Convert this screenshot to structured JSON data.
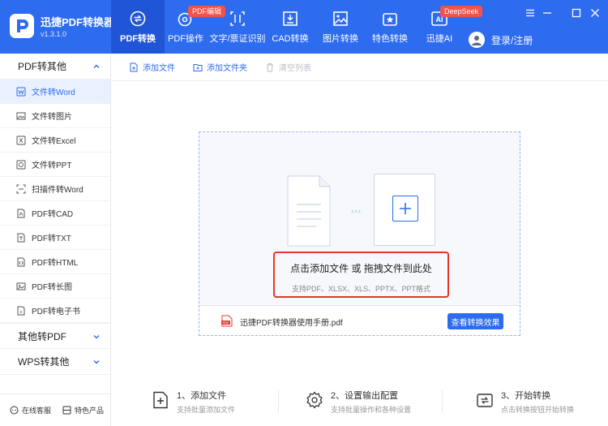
{
  "app": {
    "name": "迅捷PDF转换器",
    "version": "v1.3.1.0"
  },
  "nav": {
    "tabs": [
      {
        "label": "PDF转换",
        "icon": "convert-icon",
        "active": true
      },
      {
        "label": "PDF操作",
        "icon": "pdf-operate-icon",
        "badge": "PDF编辑"
      },
      {
        "label": "文字/票证识别",
        "icon": "ocr-scan-icon"
      },
      {
        "label": "CAD转换",
        "icon": "cad-icon"
      },
      {
        "label": "图片转换",
        "icon": "image-icon"
      },
      {
        "label": "特色转换",
        "icon": "star-icon"
      },
      {
        "label": "迅捷AI",
        "icon": "ai-icon",
        "badge": "DeepSeek"
      }
    ],
    "login_label": "登录/注册"
  },
  "sidebar": {
    "groups": [
      {
        "title": "PDF转其他",
        "expanded": true,
        "items": [
          {
            "label": "文件转Word",
            "icon": "word-icon",
            "active": true
          },
          {
            "label": "文件转图片",
            "icon": "picture-icon"
          },
          {
            "label": "文件转Excel",
            "icon": "excel-icon"
          },
          {
            "label": "文件转PPT",
            "icon": "ppt-icon"
          },
          {
            "label": "扫描件转Word",
            "icon": "scan-icon"
          },
          {
            "label": "PDF转CAD",
            "icon": "cad-file-icon"
          },
          {
            "label": "PDF转TXT",
            "icon": "txt-icon"
          },
          {
            "label": "PDF转HTML",
            "icon": "html-icon"
          },
          {
            "label": "PDF转长图",
            "icon": "long-image-icon"
          },
          {
            "label": "PDF转电子书",
            "icon": "ebook-icon"
          }
        ]
      },
      {
        "title": "其他转PDF",
        "expanded": false
      },
      {
        "title": "WPS转其他",
        "expanded": false
      }
    ],
    "footer": {
      "service_label": "在线客服",
      "features_label": "特色产品"
    }
  },
  "toolbar": {
    "add_file": "添加文件",
    "add_folder": "添加文件夹",
    "clear_list": "清空列表"
  },
  "dropzone": {
    "hint_main": "点击添加文件 或 拖拽文件到此处",
    "hint_sub": "支持PDF、XLSX、XLS、PPTX、PPT格式",
    "file_name": "迅捷PDF转换器使用手册.pdf",
    "view_button": "查看转换效果"
  },
  "steps": [
    {
      "title": "1、添加文件",
      "desc": "支持批量添加文件",
      "icon": "add-file-icon"
    },
    {
      "title": "2、设置输出配置",
      "desc": "支持批量操作和各种设置",
      "icon": "settings-icon"
    },
    {
      "title": "3、开始转换",
      "desc": "点击转换按钮开始转换",
      "icon": "start-convert-icon"
    }
  ],
  "colors": {
    "primary": "#2d6bef",
    "badge": "#f4524c",
    "highlight_border": "#e4382d"
  }
}
